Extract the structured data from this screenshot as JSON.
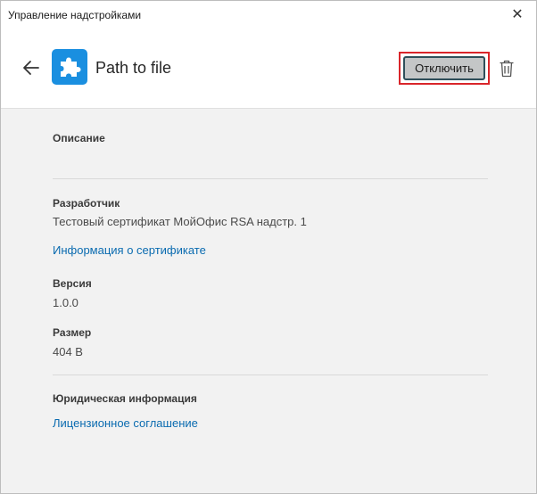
{
  "window": {
    "title": "Управление надстройками",
    "close_glyph": "✕"
  },
  "header": {
    "back_icon": "arrow-left-icon",
    "plugin_icon": "puzzle-icon",
    "plugin_name": "Path to file",
    "disable_label": "Отключить",
    "delete_icon": "trash-icon",
    "accent_color": "#1a8fe0"
  },
  "details": {
    "description_label": "Описание",
    "description_value": "",
    "developer_label": "Разработчик",
    "developer_value": "Тестовый сертификат МойОфис RSA надстр. 1",
    "cert_link": "Информация о сертификате",
    "version_label": "Версия",
    "version_value": "1.0.0",
    "size_label": "Размер",
    "size_value": "404 B",
    "legal_label": "Юридическая информация",
    "license_link": "Лицензионное соглашение"
  }
}
